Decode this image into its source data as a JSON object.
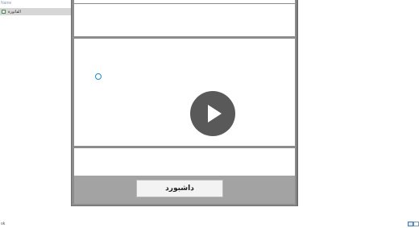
{
  "nav": {
    "header": "Name",
    "items": [
      {
        "label": "الفاتورة",
        "icon": "form-icon"
      }
    ]
  },
  "form": {
    "dashboard_button_label": "داشبورد",
    "record_indicator_icon": "circle-icon",
    "overlay_icon": "play-icon"
  },
  "status": {
    "text": "ok",
    "view_icons": [
      "form-view-icon",
      "design-view-icon"
    ]
  },
  "colors": {
    "form_background": "#8c8c8c",
    "footer_background": "#a3a3a3",
    "accent_circle": "#1f8bc8",
    "play_overlay": "#595959"
  }
}
